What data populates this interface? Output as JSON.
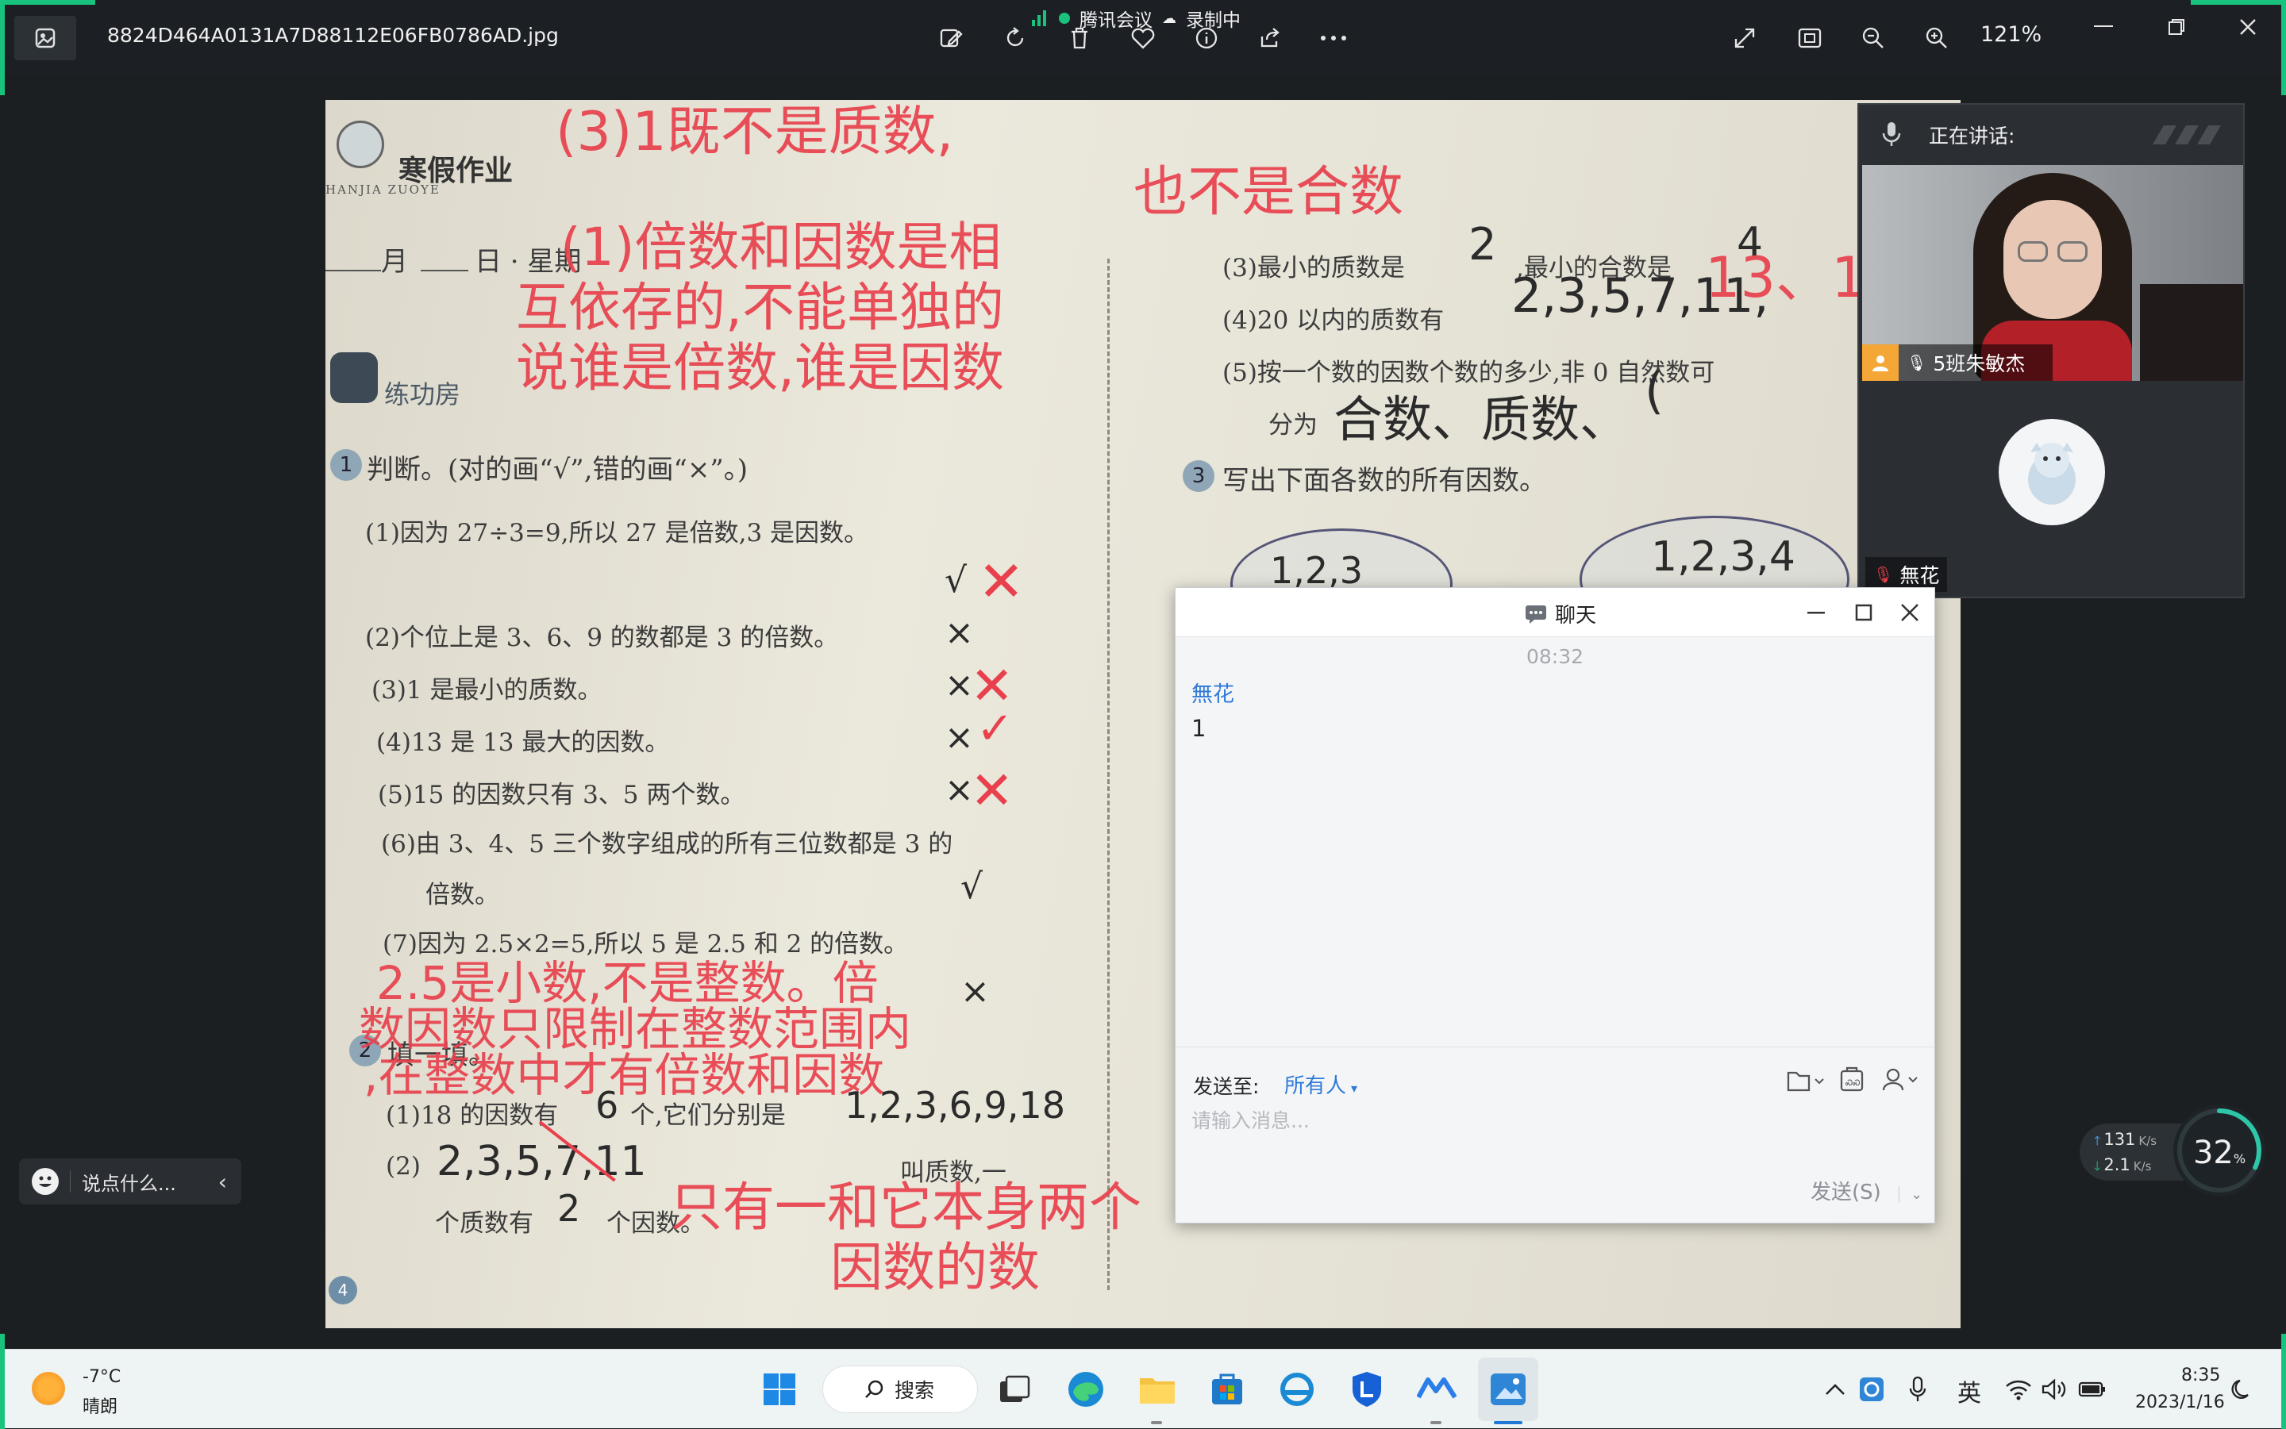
{
  "window": {
    "filename": "8824D464A0131A7D88112E06FB0786AD.jpg",
    "zoom": "121%"
  },
  "meeting": {
    "app_name": "腾讯会议",
    "recording": "录制中",
    "speaking_label": "正在讲话:",
    "speaker_name": "5班朱敏杰",
    "avatar_name": "無花"
  },
  "worksheet": {
    "header": "寒假作业",
    "header_pinyin": "HANJIA ZUOYE",
    "date_line_month": "月",
    "date_line_day": "日 · 星期",
    "section_practice": "练功房",
    "q1_title": "判断。(对的画“√”,错的画“×”。)",
    "q1_items": [
      "(1)因为 27÷3=9,所以 27 是倍数,3 是因数。",
      "(2)个位上是 3、6、9 的数都是 3 的倍数。",
      "(3)1 是最小的质数。",
      "(4)13 是 13 最大的因数。",
      "(5)15 的因数只有 3、5 两个数。",
      "(6)由 3、4、5 三个数字组成的所有三位数都是 3 的",
      "倍数。",
      "(7)因为 2.5×2=5,所以 5 是 2.5 和 2 的倍数。"
    ],
    "q2_title": "填一填。",
    "q2_item1_a": "(1)18 的因数有",
    "q2_item1_b": "个,它们分别是",
    "q2_item2_a": "(2)",
    "q2_item2_b": "叫质数,一",
    "q2_item2_c": "个质数有",
    "q2_item2_d": "个因数。",
    "right_col": {
      "item3_a": "(3)最小的质数是",
      "item3_b": ",最小的合数是",
      "item4": "(4)20 以内的质数有",
      "item5": "(5)按一个数的因数个数的多少,非 0 自然数可",
      "item5_b": "分为",
      "q3_title": "写出下面各数的所有因数。"
    },
    "handwriting": {
      "min_prime": "2",
      "min_composite": "4",
      "primes_20": "2,3,5,7,11,",
      "classify": "合数、质数、",
      "classify_end": "(",
      "circle1": "1,2,3",
      "circle2": "1,2,3,4",
      "q2_count": "6",
      "q2_list": "1,2,3,6,9,18",
      "q2_primes": "2,3,5,7,11",
      "q2_factor_count": "2",
      "mark_1": "√",
      "mark_2": "×",
      "mark_3": "×",
      "mark_4": "×",
      "mark_5": "×",
      "mark_6": "√",
      "mark_7": "×",
      "page_number": "4"
    },
    "annotations": {
      "a1": "(1)倍数和因数是相",
      "a2": "互依存的,不能单独的",
      "a3": "说谁是倍数,谁是因数",
      "top1": "(3)1既不是质数,",
      "top2": "也不是合数",
      "primes_more": "13、1",
      "mid1": "2.5是小数,不是整数。倍",
      "mid2": "数因数只限制在整数范围内",
      "mid3": ",在整数中才有倍数和因数",
      "bot1": "只有一和它本身两个",
      "bot2": "因数的数"
    }
  },
  "chat": {
    "title": "聊天",
    "time": "08:32",
    "sender": "無花",
    "message": "1",
    "send_to_label": "发送至:",
    "send_to_value": "所有人",
    "input_placeholder": "请输入消息...",
    "send_button": "发送(S)"
  },
  "sidebar": {
    "say_placeholder": "说点什么..."
  },
  "network": {
    "up": "131",
    "down": "2.1",
    "unit": "K/s",
    "cpu": "32",
    "cpu_unit": "%"
  },
  "taskbar": {
    "weather_temp": "-7°C",
    "weather_cond": "晴朗",
    "search": "搜索",
    "ime": "英",
    "time": "8:35",
    "date": "2023/1/16"
  },
  "colors": {
    "annotation_red": "#e8414d",
    "accent_blue": "#2f7ad8",
    "meeting_green": "#19c37d"
  }
}
